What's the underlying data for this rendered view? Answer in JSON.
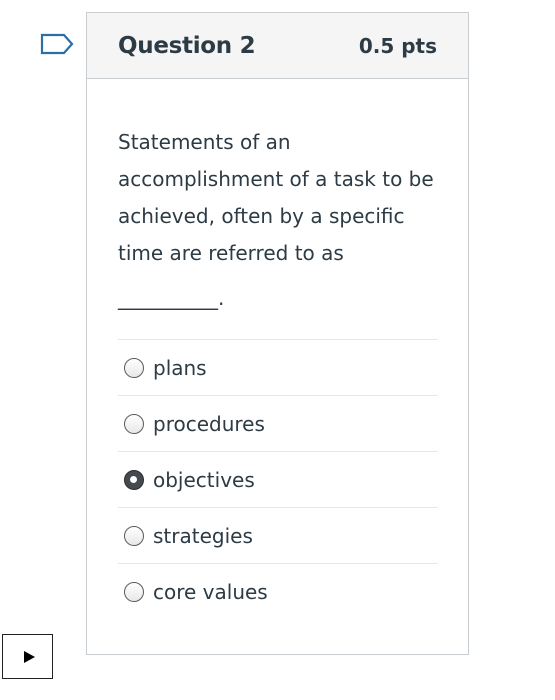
{
  "flag": {
    "icon": "flag-outline-icon",
    "color": "#2d6ea3"
  },
  "question": {
    "title": "Question 2",
    "points": "0.5 pts",
    "text": "Statements of an accomplishment of a task to be achieved, often by a specific time are referred to as",
    "blank": "__________."
  },
  "answers": [
    {
      "label": "plans",
      "selected": false
    },
    {
      "label": "procedures",
      "selected": false
    },
    {
      "label": "objectives",
      "selected": true
    },
    {
      "label": "strategies",
      "selected": false
    },
    {
      "label": "core values",
      "selected": false
    }
  ],
  "player": {
    "icon": "play-icon"
  }
}
